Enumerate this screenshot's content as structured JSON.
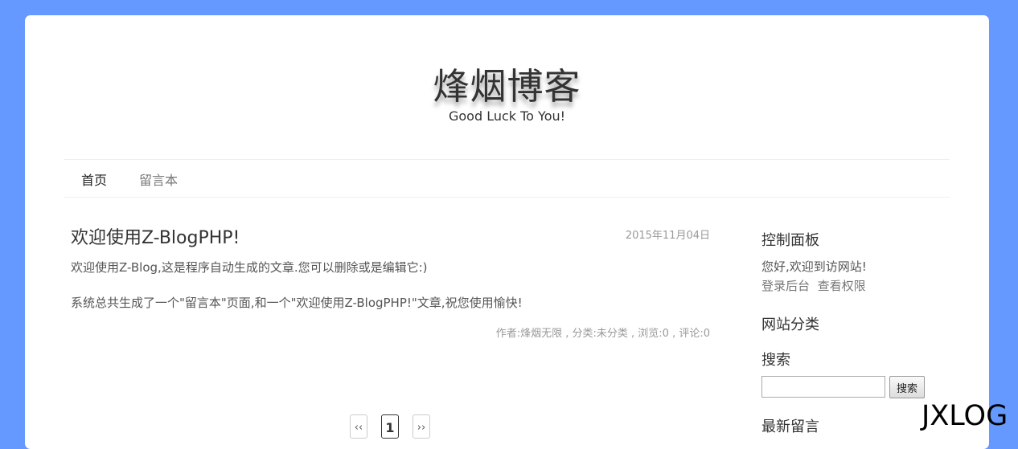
{
  "site": {
    "title": "烽烟博客",
    "subtitle": "Good Luck To You!"
  },
  "nav": {
    "items": [
      {
        "label": "首页",
        "active": true
      },
      {
        "label": "留言本",
        "active": false
      }
    ]
  },
  "post": {
    "title": "欢迎使用Z-BlogPHP!",
    "date": "2015年11月04日",
    "paragraphs": [
      "欢迎使用Z-Blog,这是程序自动生成的文章.您可以删除或是编辑它:)",
      "系统总共生成了一个\"留言本\"页面,和一个\"欢迎使用Z-BlogPHP!\"文章,祝您使用愉快!"
    ],
    "meta": "作者:烽烟无限 , 分类:未分类 , 浏览:0 , 评论:0"
  },
  "pagination": {
    "prev": "‹‹",
    "current": "1",
    "next": "››"
  },
  "sidebar": {
    "control_panel": {
      "heading": "控制面板",
      "welcome": "您好,欢迎到访网站!",
      "login_link": "登录后台",
      "permissions_link": "查看权限"
    },
    "categories": {
      "heading": "网站分类"
    },
    "search": {
      "heading": "搜索",
      "value": "",
      "button_label": "搜索"
    },
    "recent_comments": {
      "heading": "最新留言"
    }
  },
  "watermark": "JXLOG",
  "colors": {
    "background": "#6699ff",
    "panel": "#ffffff"
  }
}
